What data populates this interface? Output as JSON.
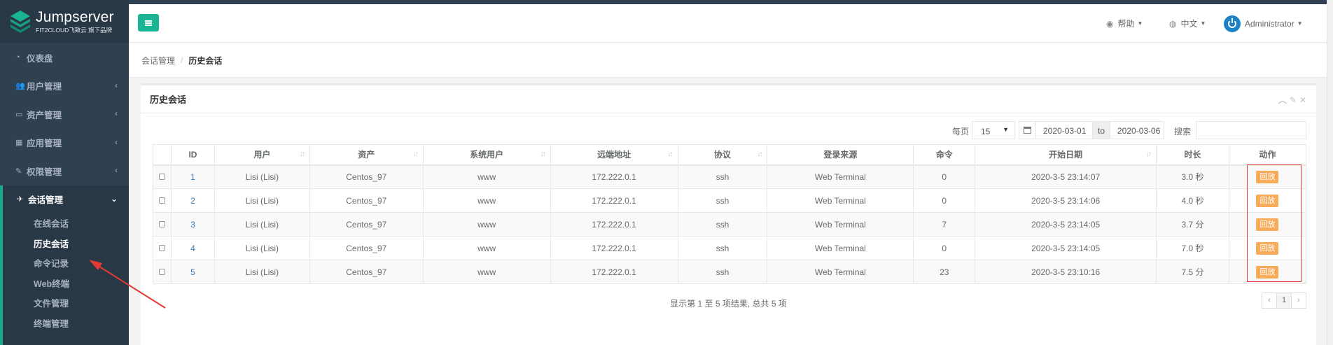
{
  "brand": {
    "title": "Jumpserver",
    "subtitle": "FIT2CLOUD飞致云 旗下品牌"
  },
  "sidebar": {
    "items": [
      {
        "label": "仪表盘",
        "icon": "dashboard-icon",
        "glyph": "◔"
      },
      {
        "label": "用户管理",
        "icon": "users-icon",
        "glyph": "👥"
      },
      {
        "label": "资产管理",
        "icon": "inbox-icon",
        "glyph": "▭"
      },
      {
        "label": "应用管理",
        "icon": "grid-icon",
        "glyph": "▦"
      },
      {
        "label": "权限管理",
        "icon": "edit-icon",
        "glyph": "✎"
      },
      {
        "label": "会话管理",
        "icon": "rocket-icon",
        "glyph": "✈"
      }
    ],
    "sub_items": [
      "在线会话",
      "历史会话",
      "命令记录",
      "Web终端",
      "文件管理",
      "终端管理"
    ]
  },
  "navbar": {
    "help": "帮助",
    "language": "中文",
    "user": "Administrator"
  },
  "breadcrumb": {
    "parent": "会话管理",
    "separator": "/",
    "current": "历史会话"
  },
  "panel": {
    "title": "历史会话"
  },
  "controls": {
    "per_page_label": "每页",
    "per_page_value": "15",
    "date_from": "2020-03-01",
    "date_to_label": "to",
    "date_to": "2020-03-06",
    "search_label": "搜索"
  },
  "table": {
    "headers": [
      "ID",
      "用户",
      "资产",
      "系统用户",
      "远端地址",
      "协议",
      "登录来源",
      "命令",
      "开始日期",
      "时长",
      "动作"
    ],
    "rows": [
      {
        "id": "1",
        "user": "Lisi (Lisi)",
        "asset": "Centos_97",
        "system_user": "www",
        "remote_addr": "172.222.0.1",
        "protocol": "ssh",
        "login_from": "Web Terminal",
        "command": "0",
        "date_start": "2020-3-5 23:14:07",
        "duration": "3.0 秒",
        "action": "回放"
      },
      {
        "id": "2",
        "user": "Lisi (Lisi)",
        "asset": "Centos_97",
        "system_user": "www",
        "remote_addr": "172.222.0.1",
        "protocol": "ssh",
        "login_from": "Web Terminal",
        "command": "0",
        "date_start": "2020-3-5 23:14:06",
        "duration": "4.0 秒",
        "action": "回放"
      },
      {
        "id": "3",
        "user": "Lisi (Lisi)",
        "asset": "Centos_97",
        "system_user": "www",
        "remote_addr": "172.222.0.1",
        "protocol": "ssh",
        "login_from": "Web Terminal",
        "command": "7",
        "date_start": "2020-3-5 23:14:05",
        "duration": "3.7 分",
        "action": "回放"
      },
      {
        "id": "4",
        "user": "Lisi (Lisi)",
        "asset": "Centos_97",
        "system_user": "www",
        "remote_addr": "172.222.0.1",
        "protocol": "ssh",
        "login_from": "Web Terminal",
        "command": "0",
        "date_start": "2020-3-5 23:14:05",
        "duration": "7.0 秒",
        "action": "回放"
      },
      {
        "id": "5",
        "user": "Lisi (Lisi)",
        "asset": "Centos_97",
        "system_user": "www",
        "remote_addr": "172.222.0.1",
        "protocol": "ssh",
        "login_from": "Web Terminal",
        "command": "23",
        "date_start": "2020-3-5 23:10:16",
        "duration": "7.5 分",
        "action": "回放"
      }
    ]
  },
  "footer": {
    "info": "显示第 1 至 5 项结果, 总共 5 项"
  },
  "pagination": {
    "prev": "‹",
    "current": "1",
    "next": "›"
  },
  "colors": {
    "sidebar": "#2f4050",
    "accent": "#1ab394",
    "playback": "#f8ac59",
    "annotation": "#e53935"
  }
}
